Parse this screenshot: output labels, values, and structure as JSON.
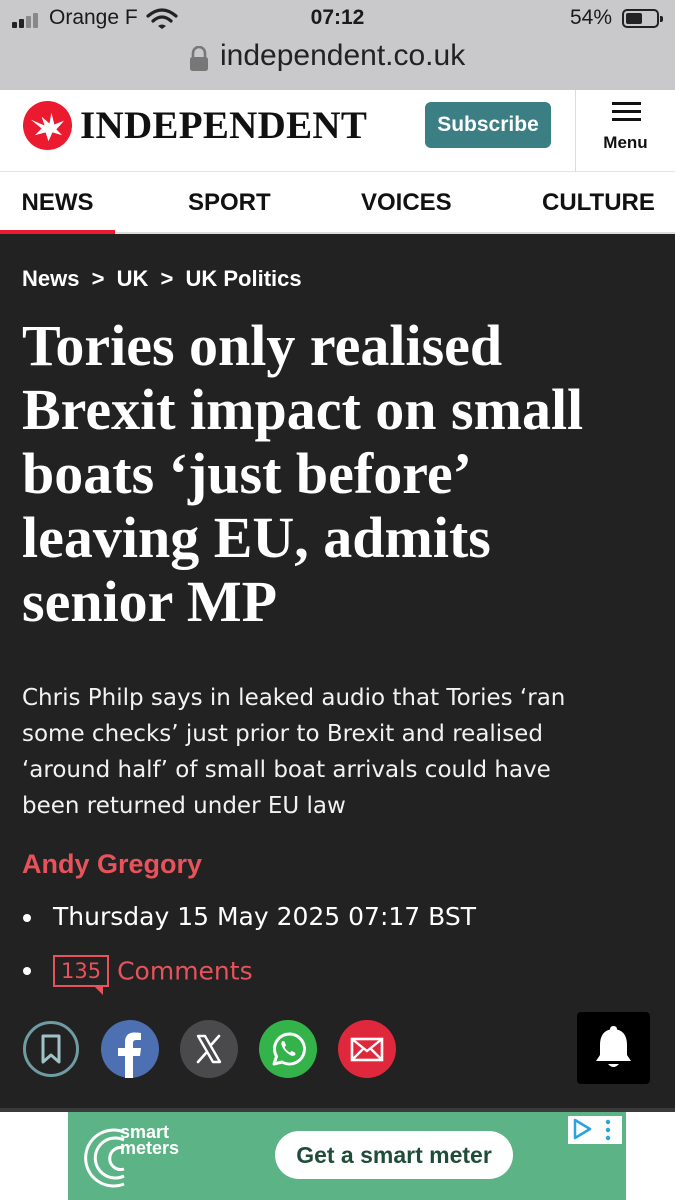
{
  "status_bar": {
    "carrier": "Orange F",
    "time": "07:12",
    "battery_pct": "54%",
    "battery_level": 0.54,
    "signal_bars_active": 2
  },
  "browser": {
    "url": "independent.co.uk"
  },
  "header": {
    "logo_text": "INDEPENDENT",
    "subscribe_label": "Subscribe",
    "menu_label": "Menu",
    "brand_color": "#ec1a2e",
    "subscribe_color": "#3b7e84"
  },
  "nav": {
    "tabs": [
      {
        "label": "NEWS",
        "active": true
      },
      {
        "label": "SPORT",
        "active": false
      },
      {
        "label": "VOICES",
        "active": false
      },
      {
        "label": "CULTURE",
        "active": false
      }
    ]
  },
  "article": {
    "breadcrumb": [
      "News",
      "UK",
      "UK Politics"
    ],
    "breadcrumb_sep": ">",
    "headline_lines": [
      "Tories only realised",
      "Brexit impact on small",
      "boats ‘just before’",
      "leaving EU, admits",
      "senior MP"
    ],
    "standfirst_lines": [
      "Chris Philp says in leaked audio that Tories ‘ran",
      "some checks’ just prior to Brexit and realised",
      "‘around half’ of small boat arrivals could have",
      "been returned under EU law"
    ],
    "author": "Andy Gregory",
    "date": "Thursday 15 May 2025 07:17 BST",
    "comment_count": "135",
    "comments_label": "Comments",
    "share_buttons": [
      "bookmark-icon",
      "facebook-icon",
      "x-icon",
      "whatsapp-icon",
      "email-icon"
    ]
  },
  "ad": {
    "logo_line1": "smart",
    "logo_line2": "meters",
    "cta": "Get a smart meter"
  }
}
